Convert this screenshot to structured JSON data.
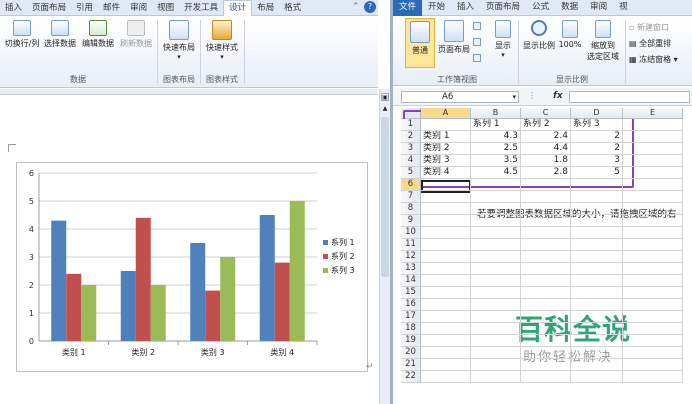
{
  "word": {
    "tabs": [
      "插入",
      "页面布局",
      "引用",
      "邮件",
      "审阅",
      "视图",
      "开发工具",
      "设计",
      "布局",
      "格式"
    ],
    "active_tab": "设计",
    "ribbon": {
      "data_group": {
        "label": "数据",
        "buttons": [
          "切换行/列",
          "选择数据",
          "编辑数据",
          "刷新数据"
        ]
      },
      "layout_group": {
        "label": "图表布局",
        "button": "快速布局"
      },
      "style_group": {
        "label": "图表样式",
        "button": "快速样式"
      }
    }
  },
  "excel": {
    "tabs": [
      "文件",
      "开始",
      "插入",
      "页面布局",
      "公式",
      "数据",
      "审阅",
      "视"
    ],
    "ribbon": {
      "workbook_views_label": "工作簿视图",
      "zoom_label": "显示比例",
      "buttons": {
        "normal": "普通",
        "page_layout": "页面布局",
        "show": "显示",
        "zoom": "显示比例",
        "zoom100": "100%",
        "zoom_sel_1": "缩放到",
        "zoom_sel_2": "选定区域",
        "new_window": "新建窗口",
        "arrange_all": "全部重排",
        "freeze": "冻结窗格"
      }
    },
    "name_box": "A6",
    "fx": "fx",
    "columns": [
      "A",
      "B",
      "C",
      "D",
      "E"
    ],
    "rows": [
      "1",
      "2",
      "3",
      "4",
      "5",
      "6",
      "7",
      "8",
      "9",
      "10",
      "11",
      "12",
      "13",
      "14",
      "15",
      "16",
      "17",
      "18",
      "19",
      "20",
      "21",
      "22"
    ],
    "table": {
      "header": [
        "",
        "系列 1",
        "系列 2",
        "系列 3"
      ],
      "rows": [
        [
          "类别 1",
          "4.3",
          "2.4",
          "2"
        ],
        [
          "类别 2",
          "2.5",
          "4.4",
          "2"
        ],
        [
          "类别 3",
          "3.5",
          "1.8",
          "3"
        ],
        [
          "类别 4",
          "4.5",
          "2.8",
          "5"
        ]
      ]
    },
    "note": "若要调整图表数据区域的大小，请拖拽区域的右"
  },
  "watermark": {
    "big": "百科全说",
    "small": "助你轻松解决"
  },
  "colors": {
    "series1": "#4f81bd",
    "series2": "#c0504d",
    "series3": "#9bbb59",
    "highlight": "#8e3fb8"
  },
  "chart_data": {
    "type": "bar",
    "categories": [
      "类别 1",
      "类别 2",
      "类别 3",
      "类别 4"
    ],
    "series": [
      {
        "name": "系列 1",
        "values": [
          4.3,
          2.5,
          3.5,
          4.5
        ]
      },
      {
        "name": "系列 2",
        "values": [
          2.4,
          4.4,
          1.8,
          2.8
        ]
      },
      {
        "name": "系列 3",
        "values": [
          2,
          2,
          3,
          5
        ]
      }
    ],
    "ylim": [
      0,
      6
    ],
    "yticks": [
      "0",
      "1",
      "2",
      "3",
      "4",
      "5",
      "6"
    ],
    "legend": "right",
    "grid": true
  }
}
